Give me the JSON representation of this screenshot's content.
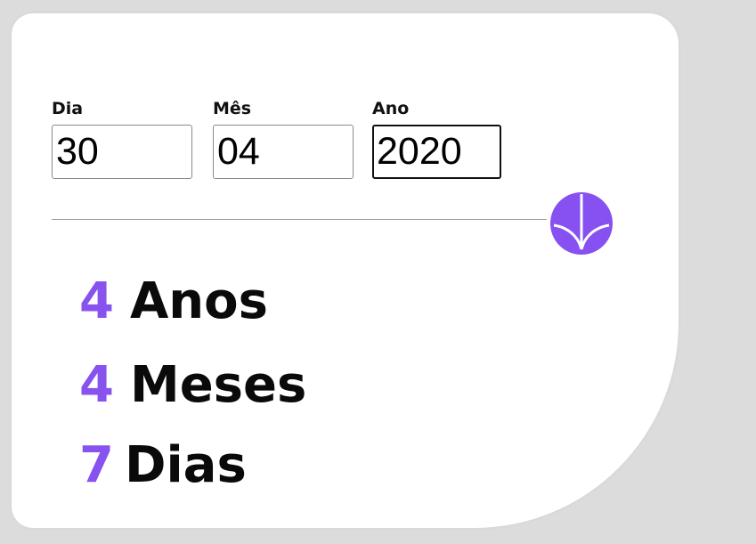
{
  "form": {
    "day": {
      "label": "Dia",
      "value": "30"
    },
    "month": {
      "label": "Mês",
      "value": "04"
    },
    "year": {
      "label": "Ano",
      "value": "2020"
    }
  },
  "submit": {
    "icon": "arrow-down-icon",
    "color": "#8750f0"
  },
  "results": {
    "years": {
      "number": "4",
      "unit": "Anos"
    },
    "months": {
      "number": "4",
      "unit": "Meses"
    },
    "days": {
      "number": "7",
      "unit": "Dias"
    }
  },
  "colors": {
    "accent": "#8752ee",
    "background": "#dcdcdc",
    "card": "#ffffff"
  }
}
